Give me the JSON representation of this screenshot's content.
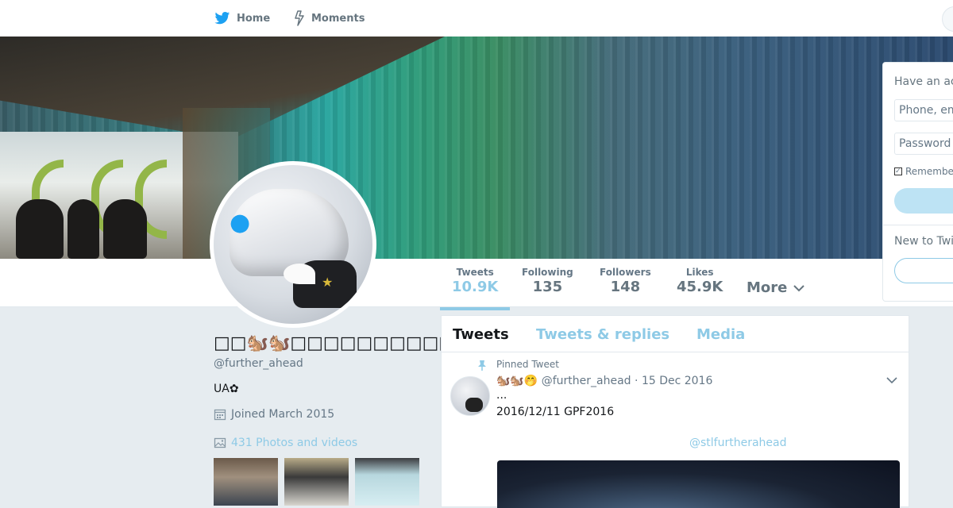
{
  "nav": {
    "home_label": "Home",
    "moments_label": "Moments"
  },
  "profile": {
    "name": "□□🐿️🐿️□□□□□□□□□□□🤭",
    "handle": "@further_ahead",
    "bio": "UA✿",
    "joined": "Joined March 2015",
    "photos_link": "431 Photos and videos"
  },
  "stats": [
    {
      "label": "Tweets",
      "value": "10.9K"
    },
    {
      "label": "Following",
      "value": "135"
    },
    {
      "label": "Followers",
      "value": "148"
    },
    {
      "label": "Likes",
      "value": "45.9K"
    }
  ],
  "more_label": "More",
  "tabs": [
    "Tweets",
    "Tweets & replies",
    "Media"
  ],
  "tweet": {
    "pinned_label": "Pinned Tweet",
    "emoji_name": "🐿️🐿️🤭",
    "handle": "@further_ahead",
    "date": "15 Dec 2016",
    "dots": "...",
    "text": "2016/12/11 GPF2016",
    "mention": "@stlfurtherahead"
  },
  "login": {
    "title": "Have an ac",
    "phone_placeholder": "Phone, em",
    "password_placeholder": "Password",
    "remember_label": "Remembe",
    "new_to_label": "New to Twi"
  },
  "colors": {
    "accent": "#8ecae6",
    "twitter_blue": "#1da1f2",
    "background": "#e6ecf0"
  }
}
